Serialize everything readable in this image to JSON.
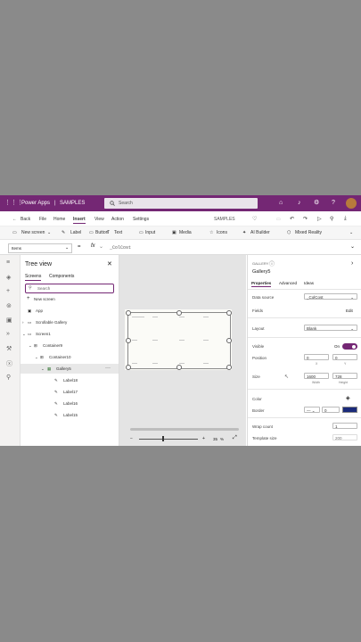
{
  "titlebar": {
    "app": "Power Apps",
    "sep": "|",
    "project": "SAMPLES",
    "search_placeholder": "Search",
    "user_initials": "JP"
  },
  "menubar": {
    "back": "Back",
    "file": "File",
    "home": "Home",
    "insert": "Insert",
    "view": "View",
    "action": "Action",
    "settings": "Settings",
    "app_name": "SAMPLES"
  },
  "toolbar": {
    "new_screen": "New screen",
    "label": "Label",
    "button": "Button",
    "text": "Text",
    "input": "Input",
    "media": "Media",
    "icons": "Icons",
    "ai_builder": "AI Builder",
    "mixed_reality": "Mixed Reality"
  },
  "formulabar": {
    "property": "Items",
    "eq": "=",
    "fx": "fx",
    "formula": "_ColCost"
  },
  "tree": {
    "title": "Tree view",
    "tab_screens": "Screens",
    "tab_components": "Components",
    "search_placeholder": "Search",
    "new_screen": "New screen",
    "items": [
      "App",
      "Scrollable Gallery",
      "Screen1",
      "Container9",
      "Container10",
      "Gallery5",
      "Label18",
      "Label17",
      "Label16",
      "Label15"
    ]
  },
  "canvas": {
    "zoom": "35",
    "zoom_unit": "%"
  },
  "props": {
    "type": "GALLERY",
    "name": "Gallery5",
    "tabs": [
      "Properties",
      "Advanced",
      "Ideas"
    ],
    "data_source_label": "Data source",
    "data_source_value": "_ColCost",
    "fields_label": "Fields",
    "fields_edit": "Edit",
    "layout_label": "Layout",
    "layout_value": "Blank",
    "visible_label": "Visible",
    "visible_value": "On",
    "position_label": "Position",
    "position_x": "0",
    "position_y": "0",
    "x_caption": "X",
    "y_caption": "Y",
    "size_label": "Size",
    "size_w": "1600",
    "size_h": "728",
    "width_caption": "Width",
    "height_caption": "Height",
    "color_label": "Color",
    "border_label": "Border",
    "border_value": "0",
    "border_color": "#1a2a7a",
    "wrap_label": "Wrap count",
    "wrap_value": "1",
    "template_label": "Template size",
    "template_value": "200"
  }
}
